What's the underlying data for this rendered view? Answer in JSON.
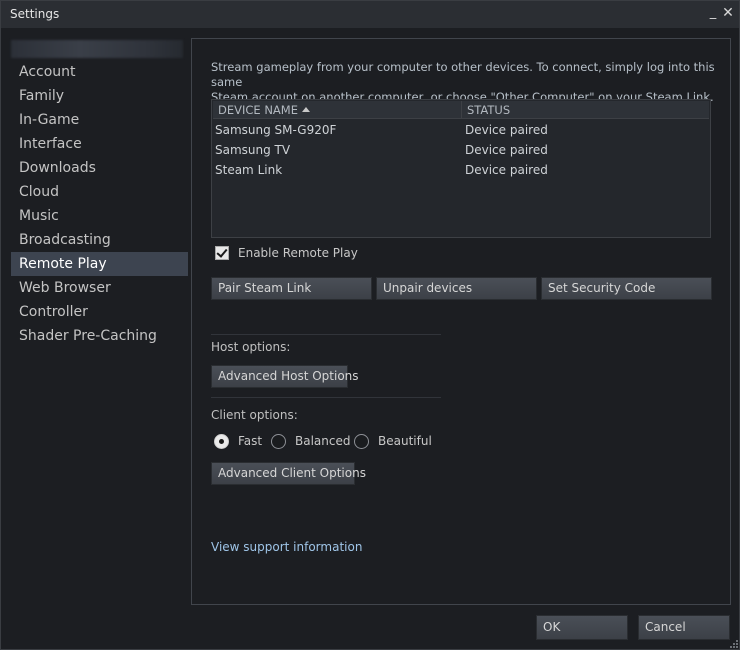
{
  "window": {
    "title": "Settings",
    "minimize_icon": "minimize-icon",
    "close_icon": "close-icon"
  },
  "sidebar": {
    "items": [
      {
        "label": "Account"
      },
      {
        "label": "Family"
      },
      {
        "label": "In-Game"
      },
      {
        "label": "Interface"
      },
      {
        "label": "Downloads"
      },
      {
        "label": "Cloud"
      },
      {
        "label": "Music"
      },
      {
        "label": "Broadcasting"
      },
      {
        "label": "Remote Play",
        "active": true
      },
      {
        "label": "Web Browser"
      },
      {
        "label": "Controller"
      },
      {
        "label": "Shader Pre-Caching"
      }
    ]
  },
  "remote_play": {
    "description_line1": "Stream gameplay from your computer to other devices. To connect, simply log into this same",
    "description_line2": "Steam account on another computer, or choose \"Other Computer\" on your Steam Link.",
    "table": {
      "columns": [
        "DEVICE NAME",
        "STATUS"
      ],
      "sort_icon": "sort-ascending-icon",
      "rows": [
        {
          "name": "Samsung SM-G920F",
          "status": "Device paired"
        },
        {
          "name": "Samsung TV",
          "status": "Device paired"
        },
        {
          "name": "Steam Link",
          "status": "Device paired"
        }
      ]
    },
    "enable_label": "Enable Remote Play",
    "enable_checked": true,
    "buttons": {
      "pair": "Pair Steam Link",
      "unpair": "Unpair devices",
      "security": "Set Security Code"
    },
    "host_label": "Host options:",
    "host_button": "Advanced Host Options",
    "client_label": "Client options:",
    "client_options": [
      {
        "label": "Fast",
        "checked": true
      },
      {
        "label": "Balanced",
        "checked": false
      },
      {
        "label": "Beautiful",
        "checked": false
      }
    ],
    "client_button": "Advanced Client Options",
    "support_link": "View support information"
  },
  "footer": {
    "ok": "OK",
    "cancel": "Cancel"
  },
  "colors": {
    "background": "#1c1e22",
    "active_nav": "#3d4450",
    "link": "#9fc5e8"
  }
}
